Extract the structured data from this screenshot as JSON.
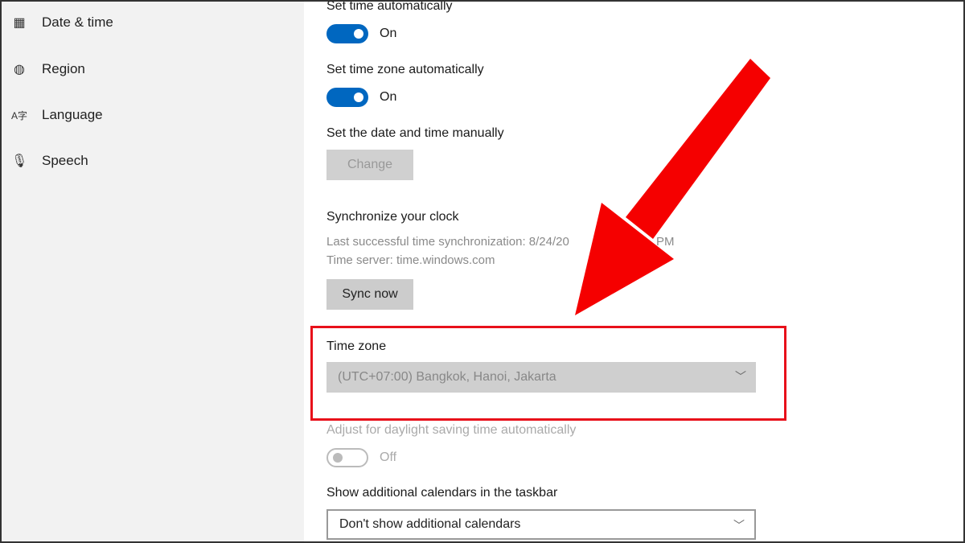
{
  "sidebar": {
    "items": [
      {
        "label": "Date & time",
        "icon": "calendar-clock-icon"
      },
      {
        "label": "Region",
        "icon": "globe-icon"
      },
      {
        "label": "Language",
        "icon": "language-icon"
      },
      {
        "label": "Speech",
        "icon": "microphone-icon"
      }
    ]
  },
  "main": {
    "set_time_auto": {
      "label": "Set time automatically",
      "state": "On"
    },
    "set_tz_auto": {
      "label": "Set time zone automatically",
      "state": "On"
    },
    "manual": {
      "label": "Set the date and time manually",
      "button": "Change"
    },
    "sync": {
      "title": "Synchronize your clock",
      "last": "Last successful time synchronization: 8/24/20",
      "last_tail": "PM",
      "server": "Time server: time.windows.com",
      "button": "Sync now"
    },
    "timezone": {
      "label": "Time zone",
      "value": "(UTC+07:00) Bangkok, Hanoi, Jakarta"
    },
    "dst": {
      "label": "Adjust for daylight saving time automatically",
      "state": "Off"
    },
    "calendars": {
      "label": "Show additional calendars in the taskbar",
      "value": "Don't show additional calendars"
    }
  },
  "colors": {
    "accent": "#0067c0",
    "annotation": "#e8101a"
  }
}
